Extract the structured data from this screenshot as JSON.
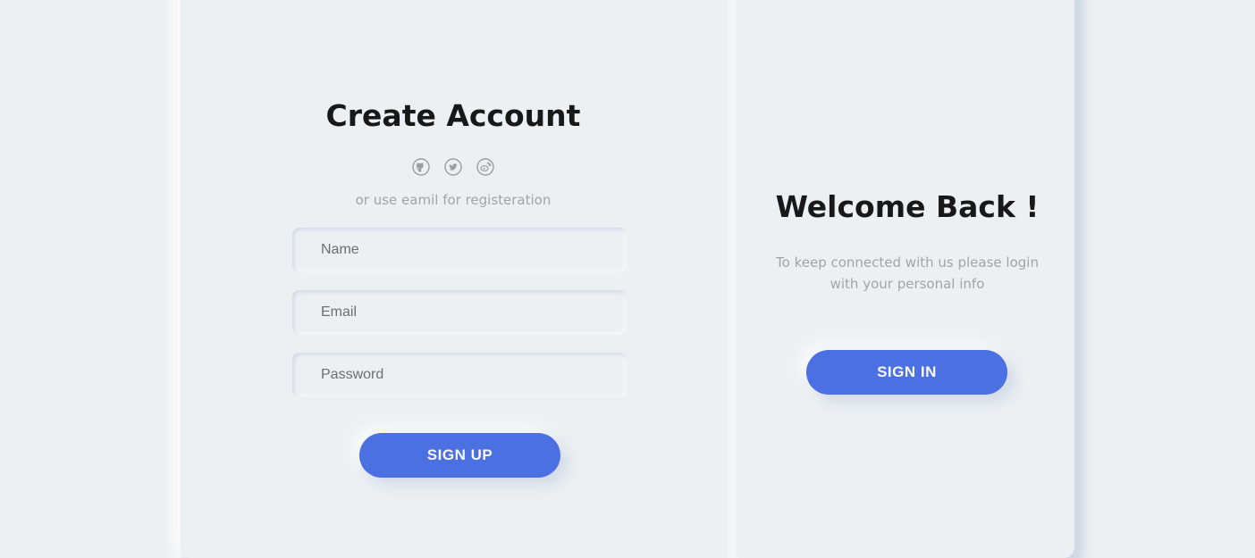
{
  "signup": {
    "title": "Create Account",
    "social_icons": [
      "github-icon",
      "twitter-icon",
      "weibo-icon"
    ],
    "hint": "or use eamil for registeration",
    "fields": {
      "name_placeholder": "Name",
      "email_placeholder": "Email",
      "password_placeholder": "Password"
    },
    "button_label": "SIGN UP"
  },
  "welcome": {
    "title": "Welcome Back !",
    "text": "To keep connected with us please login with your personal info",
    "button_label": "SIGN IN"
  },
  "colors": {
    "background": "#ecf0f3",
    "accent": "#4b70e2",
    "muted_text": "#a0a5a8",
    "title_text": "#181818"
  }
}
